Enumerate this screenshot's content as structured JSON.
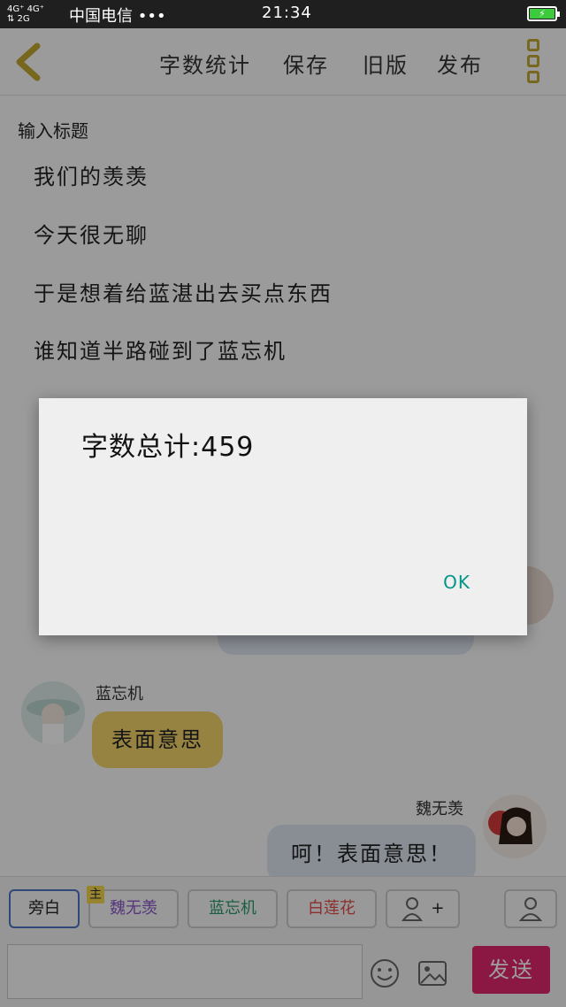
{
  "status_bar": {
    "signal_top": "4G⁺ 4G⁺",
    "signal_bottom": "⇅ 2G",
    "carrier": "中国电信 •••",
    "time": "21:34",
    "battery_icon": "battery-charging-icon"
  },
  "toolbar": {
    "word_count": "字数统计",
    "save": "保存",
    "old_version": "旧版",
    "publish": "发布"
  },
  "title_placeholder": "输入标题",
  "story_lines": [
    "我们的羡羡",
    "今天很无聊",
    "于是想着给蓝湛出去买点东西",
    "谁知道半路碰到了蓝忘机"
  ],
  "chat": [
    {
      "speaker": "蓝忘机",
      "text": "表面意思",
      "side": "left",
      "color": "#f3d36a"
    },
    {
      "speaker": "魏无羡",
      "text": "呵！表面意思！",
      "side": "right",
      "color": "#dde5f0"
    }
  ],
  "roles": [
    {
      "label": "旁白",
      "color": "#333333"
    },
    {
      "label": "魏无羡",
      "color": "#8a56c8",
      "badge": "主"
    },
    {
      "label": "蓝忘机",
      "color": "#2a9a6a"
    },
    {
      "label": "白莲花",
      "color": "#e24b4b"
    }
  ],
  "add_role_label": "+",
  "send_label": "发送",
  "dialog": {
    "message": "字数总计:459",
    "ok_label": "OK"
  },
  "colors": {
    "accent_yellow": "#c2a832",
    "send": "#e0286b",
    "ok": "#009688"
  }
}
